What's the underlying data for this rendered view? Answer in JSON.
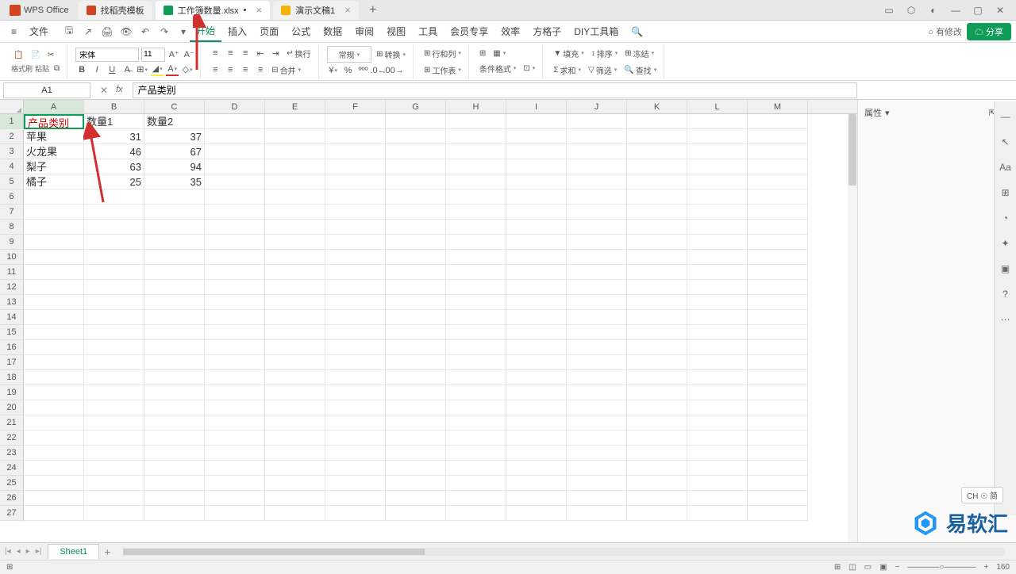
{
  "app": {
    "name": "WPS Office"
  },
  "tabs": [
    {
      "label": "找稻壳模板",
      "icon": "red"
    },
    {
      "label": "工作簿数量.xlsx",
      "icon": "green",
      "active": true,
      "modified": true
    },
    {
      "label": "演示文稿1",
      "icon": "orange"
    }
  ],
  "menubar": {
    "file": "文件",
    "items": [
      "开始",
      "插入",
      "页面",
      "公式",
      "数据",
      "审阅",
      "视图",
      "工具",
      "会员专享",
      "效率",
      "方格子",
      "DIY工具箱"
    ],
    "modify": "有修改",
    "share": "分享"
  },
  "toolbar": {
    "brush": "格式刷",
    "paste": "粘贴",
    "font": "宋体",
    "size": "11",
    "wrap": "换行",
    "merge": "合并",
    "general": "常规",
    "convert": "转换",
    "rowcol": "行和列",
    "sheet": "工作表",
    "condfmt": "条件格式",
    "fill": "填充",
    "sort": "排序",
    "freeze": "冻结",
    "sum": "求和",
    "filter": "筛选",
    "find": "查找"
  },
  "namebox": "A1",
  "formula": "产品类别",
  "panel": {
    "title": "属性"
  },
  "columns": [
    "A",
    "B",
    "C",
    "D",
    "E",
    "F",
    "G",
    "H",
    "I",
    "J",
    "K",
    "L",
    "M"
  ],
  "rowNums": [
    1,
    2,
    3,
    4,
    5,
    6,
    7,
    8,
    9,
    10,
    11,
    12,
    13,
    14,
    15,
    16,
    17,
    18,
    19,
    20,
    21,
    22,
    23,
    24,
    25,
    26,
    27
  ],
  "data": {
    "r1": {
      "A": "产品类别",
      "B": "数量1",
      "C": "数量2"
    },
    "r2": {
      "A": "苹果",
      "B": "31",
      "C": "37"
    },
    "r3": {
      "A": "火龙果",
      "B": "46",
      "C": "67"
    },
    "r4": {
      "A": "梨子",
      "B": "63",
      "C": "94"
    },
    "r5": {
      "A": "橘子",
      "B": "25",
      "C": "35"
    }
  },
  "sheet": "Sheet1",
  "ime": "CH ☉ 简",
  "zoom": "160",
  "watermark": "易软汇",
  "chart_data": {
    "type": "table",
    "title": "",
    "categories": [
      "产品类别",
      "数量1",
      "数量2"
    ],
    "series": [
      {
        "name": "苹果",
        "values": [
          31,
          37
        ]
      },
      {
        "name": "火龙果",
        "values": [
          46,
          67
        ]
      },
      {
        "name": "梨子",
        "values": [
          63,
          94
        ]
      },
      {
        "name": "橘子",
        "values": [
          25,
          35
        ]
      }
    ]
  }
}
